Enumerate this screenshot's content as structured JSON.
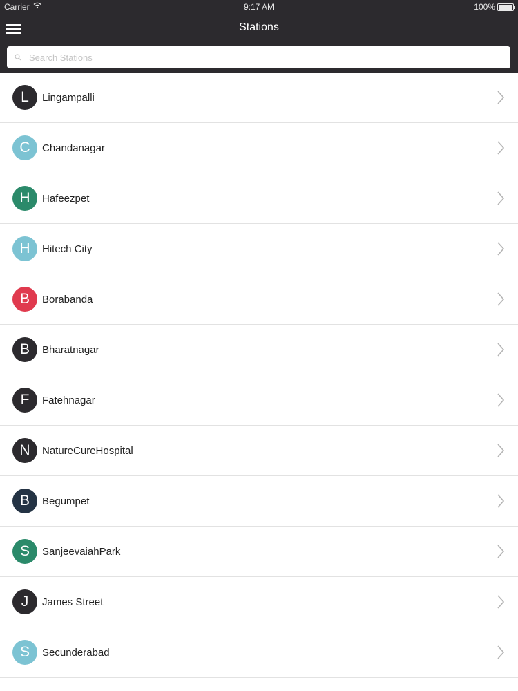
{
  "status_bar": {
    "carrier": "Carrier",
    "time": "9:17 AM",
    "battery": "100%"
  },
  "nav": {
    "title": "Stations",
    "menu_icon": "hamburger-menu-icon"
  },
  "search": {
    "placeholder": "Search Stations",
    "value": "",
    "icon": "search-icon"
  },
  "colors": {
    "nav_background": "#2c2a2e",
    "avatar_dark": "#2c2a2e",
    "avatar_light_blue": "#7cc3d3",
    "avatar_green": "#2b8a6a",
    "avatar_red": "#e03a4e",
    "avatar_navy": "#243344"
  },
  "stations": [
    {
      "initial": "L",
      "name": "Lingampalli",
      "color": "#2c2a2e"
    },
    {
      "initial": "C",
      "name": "Chandanagar",
      "color": "#7cc3d3"
    },
    {
      "initial": "H",
      "name": "Hafeezpet",
      "color": "#2b8a6a"
    },
    {
      "initial": "H",
      "name": "Hitech City",
      "color": "#7cc3d3"
    },
    {
      "initial": "B",
      "name": "Borabanda",
      "color": "#e03a4e"
    },
    {
      "initial": "B",
      "name": "Bharatnagar",
      "color": "#2c2a2e"
    },
    {
      "initial": "F",
      "name": "Fatehnagar",
      "color": "#2c2a2e"
    },
    {
      "initial": "N",
      "name": "NatureCureHospital",
      "color": "#2c2a2e"
    },
    {
      "initial": "B",
      "name": "Begumpet",
      "color": "#243344"
    },
    {
      "initial": "S",
      "name": "SanjeevaiahPark",
      "color": "#2b8a6a"
    },
    {
      "initial": "J",
      "name": "James Street",
      "color": "#2c2a2e"
    },
    {
      "initial": "S",
      "name": "Secunderabad",
      "color": "#7cc3d3"
    }
  ]
}
